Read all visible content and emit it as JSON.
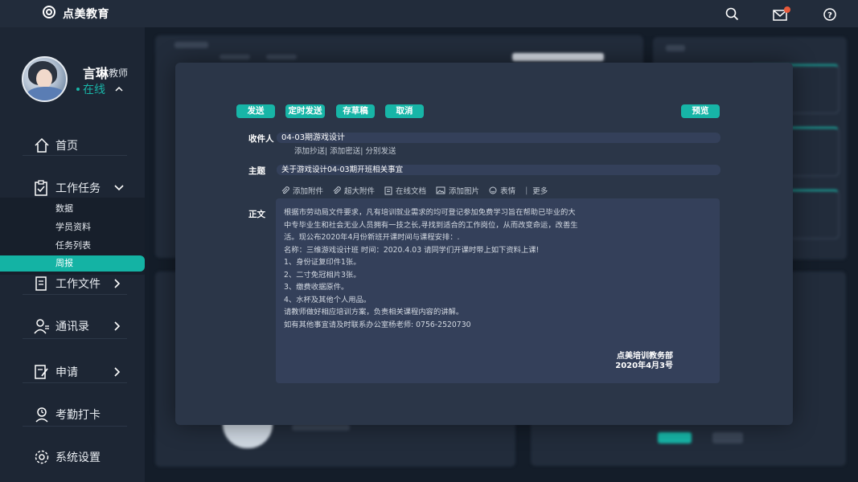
{
  "app": {
    "title": "点美教育"
  },
  "topbar": {
    "mail_badge_color": "#e8593a"
  },
  "user": {
    "name": "言琳",
    "role": "教师",
    "status": "在线"
  },
  "sidebar": {
    "items": [
      {
        "label": "首页",
        "icon": "home-icon"
      },
      {
        "label": "工作任务",
        "icon": "clipboard-icon"
      },
      {
        "label": "工作文件",
        "icon": "document-icon"
      },
      {
        "label": "通讯录",
        "icon": "contacts-icon"
      },
      {
        "label": "申请",
        "icon": "edit-form-icon"
      },
      {
        "label": "考勤打卡",
        "icon": "attendance-icon"
      },
      {
        "label": "系统设置",
        "icon": "gear-icon"
      }
    ],
    "submenu": [
      "数据",
      "学员资料",
      "任务列表",
      "周报"
    ],
    "active_sub": "周报"
  },
  "compose": {
    "toolbar": {
      "send": "发送",
      "schedule": "定时发送",
      "draft": "存草稿",
      "cancel": "取消",
      "preview": "预览"
    },
    "recipient_label": "收件人",
    "recipient_value": "04-03期游戏设计",
    "extra_options": "添加抄送| 添加密送| 分别发送",
    "subject_label": "主题",
    "subject_value": "关于游戏设计04-03期开班相关事宜",
    "attach": {
      "attachment": "添加附件",
      "large": "超大附件",
      "doc": "在线文档",
      "image": "添加图片",
      "emoji": "表情",
      "more": "更多"
    },
    "body_label": "正文",
    "body_lines": [
      "根据市劳动局文件要求，凡有培训就业需求的均可登记参加免费学习旨在帮助已毕业的大",
      "中专毕业生和社会无业人员拥有一技之长,寻找到适合的工作岗位，从而改变命运，改善生",
      "活。现公布2020年4月份新班开课时间与课程安排：.",
      "名称：三维游戏设计班   时间：2020.4.03  请同学们开课时带上如下资料上课!",
      "1、身份证复印件1张。",
      "2、二寸免冠相片3张。",
      "3、缴费收据原件。",
      "4、水杯及其他个人用品。",
      "请教师做好相应培训方案，负责相关课程内容的讲解。",
      "如有其他事宜请及时联系办公室杨老师: 0756-2520730"
    ],
    "signature_org": "点美培训教务部",
    "signature_date": "2020年4月3号"
  },
  "colors": {
    "accent": "#17b5a7",
    "background": "#141d29",
    "modal": "#2b3648"
  }
}
